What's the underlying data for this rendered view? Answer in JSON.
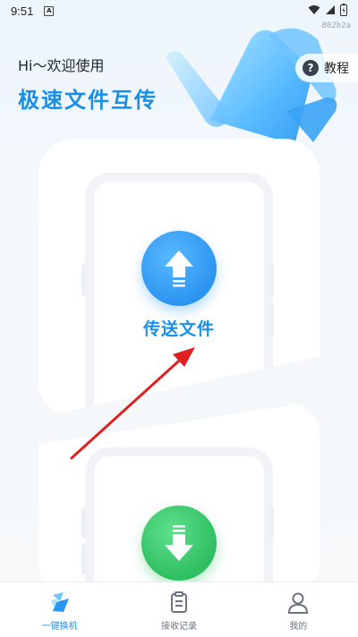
{
  "status_bar": {
    "time": "9:51",
    "notification_letter": "A"
  },
  "build_id": "802b2a",
  "hero": {
    "greeting": "Hi～欢迎使用",
    "title": "极速文件互传"
  },
  "tutorial": {
    "label": "教程",
    "icon": "help-icon"
  },
  "send": {
    "label": "传送文件",
    "icon": "upload-arrow-icon"
  },
  "receive": {
    "icon": "download-arrow-icon"
  },
  "colors": {
    "accent": "#1a8fe8",
    "send": "#2c95f0",
    "receive": "#2fbe61",
    "annotation": "#e02020"
  },
  "nav": {
    "items": [
      {
        "label": "一键换机",
        "icon": "swap-phone-icon",
        "active": true
      },
      {
        "label": "接收记录",
        "icon": "clipboard-icon",
        "active": false
      },
      {
        "label": "我的",
        "icon": "person-icon",
        "active": false
      }
    ]
  }
}
